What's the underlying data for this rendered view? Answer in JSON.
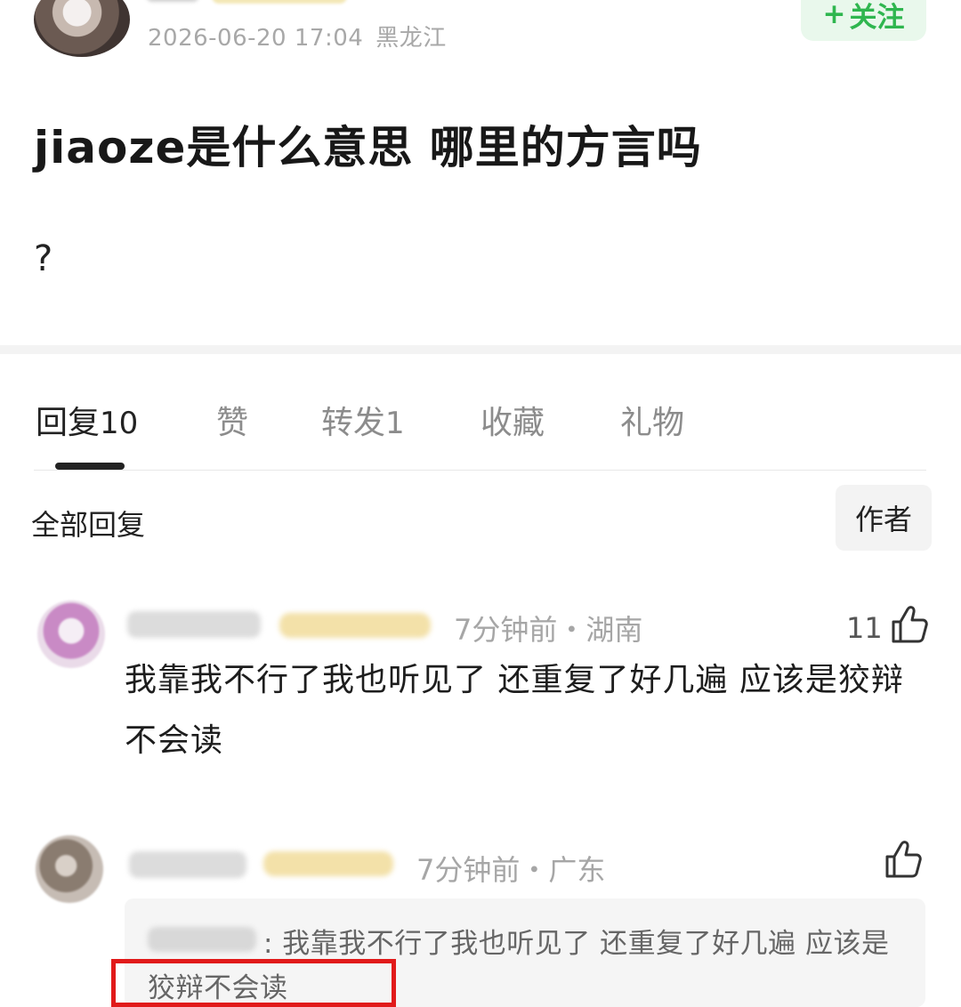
{
  "post": {
    "meta_time": "2026-06-20 17:04",
    "meta_location": "黑龙江",
    "follow_label": "关注",
    "title": "jiaoze是什么意思 哪里的方言吗",
    "body": "?"
  },
  "tabs": [
    {
      "label": "回复",
      "count": "10"
    },
    {
      "label": "赞",
      "count": ""
    },
    {
      "label": "转发",
      "count": "1"
    },
    {
      "label": "收藏",
      "count": ""
    },
    {
      "label": "礼物",
      "count": ""
    }
  ],
  "filter": {
    "all_label": "全部回复",
    "author_label": "作者"
  },
  "comments": [
    {
      "meta": "7分钟前・湖南",
      "likes": "11",
      "text": "我靠我不行了我也听见了 还重复了好几遍 应该是狡辩不会读"
    },
    {
      "meta": "7分钟前・广东",
      "likes": "",
      "quote": ": 我靠我不行了我也听见了 还重复了好几遍 应该是狡辩不会读"
    }
  ],
  "colors": {
    "accent_green": "#2fb64f",
    "highlight_red": "#e11a1a"
  }
}
